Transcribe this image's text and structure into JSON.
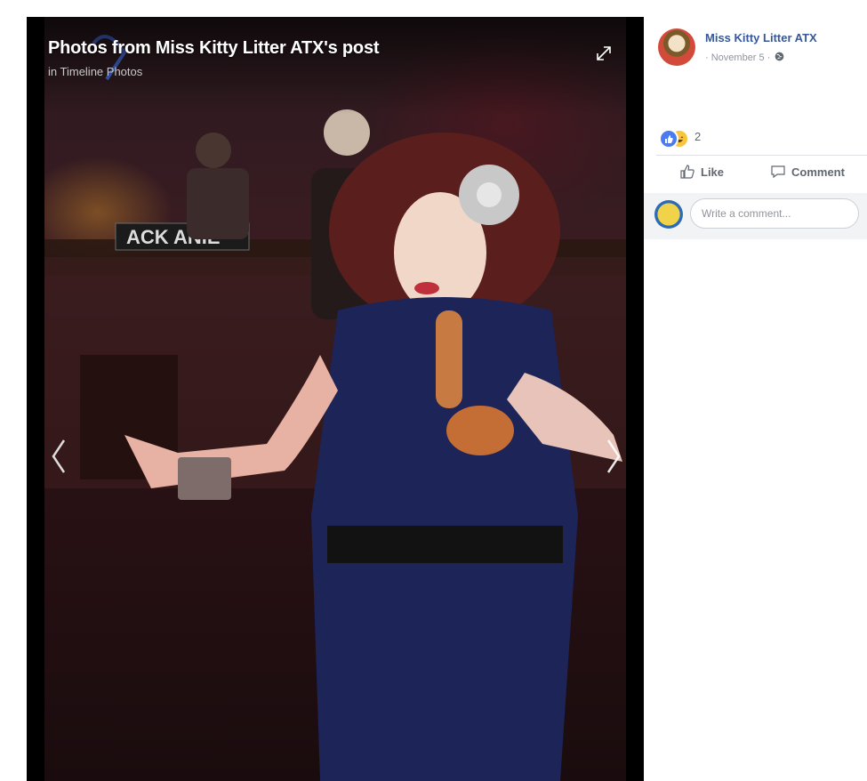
{
  "viewer": {
    "title": "Photos from Miss Kitty Litter ATX's post",
    "sub_prefix": "in",
    "sub_album": "Timeline Photos"
  },
  "photo": {
    "sign_text": "ACK  ANIE",
    "description": "Performer in a navy dress with long satin gloves and a silver flower in the hair, on a dimly lit bar stage"
  },
  "post": {
    "author": "Miss Kitty Litter ATX",
    "date": "November 5",
    "date_prefix": "·",
    "date_suffix": "·",
    "reactions": {
      "count": "2",
      "types": [
        "like",
        "haha"
      ]
    },
    "actions": {
      "like": "Like",
      "comment": "Comment"
    },
    "comment_placeholder": "Write a comment..."
  },
  "colors": {
    "link_blue": "#365899",
    "meta_gray": "#90949c",
    "action_gray": "#606770",
    "like_blue": "#4b7bf0",
    "haha_yellow": "#f7c63a"
  },
  "icons": [
    "expand-icon",
    "chevron-left-icon",
    "chevron-right-icon",
    "globe-icon",
    "like-thumb-icon",
    "comment-bubble-icon",
    "like-reaction-icon",
    "haha-reaction-icon"
  ]
}
